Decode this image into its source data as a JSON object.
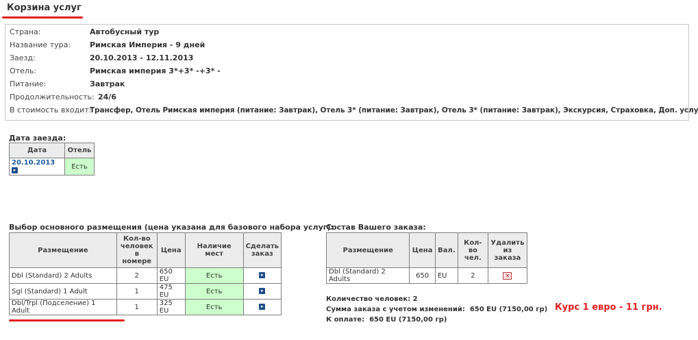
{
  "page": {
    "title": "Корзина услуг",
    "colors": {
      "accent_red": "#e02020",
      "available_green": "#ccffcc",
      "link_blue": "#1f5aa0"
    }
  },
  "tour_info": {
    "country_label": "Страна:",
    "country_value": "Автобусный тур",
    "tour_name_label": "Название тура:",
    "tour_name_value": "Римская Империя - 9 дней",
    "checkin_label": "Заезд:",
    "checkin_value": "20.10.2013 - 12.11.2013",
    "hotel_label": "Отель:",
    "hotel_value": "Римская империя 3*+3* -+3* -",
    "meal_label": "Питание:",
    "meal_value": "Завтрак",
    "duration_label": "Продолжительность:",
    "duration_value": "24/6",
    "includes_label": "В стоимость входит:",
    "includes_value": "Трансфер, Отель Римская империя (питание: Завтрак), Отель 3* (питание: Завтрак), Отель 3* (питание: Завтрак), Экскурсия, Страховка, Доп. услуги"
  },
  "checkin_date": {
    "title": "Дата заезда:",
    "headers": [
      "Дата",
      "Отель"
    ],
    "row": {
      "date": "20.10.2013",
      "date_icon": "arrow-right-icon",
      "hotel": "Есть"
    }
  },
  "accommodation": {
    "title": "Выбор основного размещения (цена указана для базового набора услуг):",
    "headers": {
      "placement": "Размещение",
      "people": "Кол-во человек в номере",
      "price": "Цена",
      "availability": "Наличие мест",
      "order": "Сделать заказ"
    },
    "rows": [
      {
        "placement": "Dbl (Standard) 2 Adults",
        "people": "2",
        "price": "650 EU",
        "availability": "Есть"
      },
      {
        "placement": "Sgl (Standard) 1 Adult",
        "people": "1",
        "price": "475 EU",
        "availability": "Есть"
      },
      {
        "placement": "Dbl/Trpl (Подселение) 1 Adult",
        "people": "1",
        "price": "325 EU",
        "availability": "Есть"
      }
    ],
    "order_icon": "arrow-right-icon"
  },
  "order": {
    "title": "Состав Вашего заказа:",
    "headers": {
      "placement": "Размещение",
      "price": "Цена",
      "currency": "Вал.",
      "people": "Кол-во чел.",
      "delete": "Удалить из заказа"
    },
    "row": {
      "placement": "Dbl (Standard) 2 Adults",
      "price": "650",
      "currency": "EU",
      "people": "2",
      "delete_icon": "delete-icon"
    }
  },
  "summary": {
    "people_line": "Количество человек: 2",
    "sum_label": "Сумма заказа с учетом изменений:",
    "sum_value": "650 EU (7150,00 гр)",
    "pay_label": "К оплате:",
    "pay_value": "650 EU (7150,00 гр)",
    "rate_text": "Курс  1 евро - 11 грн."
  }
}
